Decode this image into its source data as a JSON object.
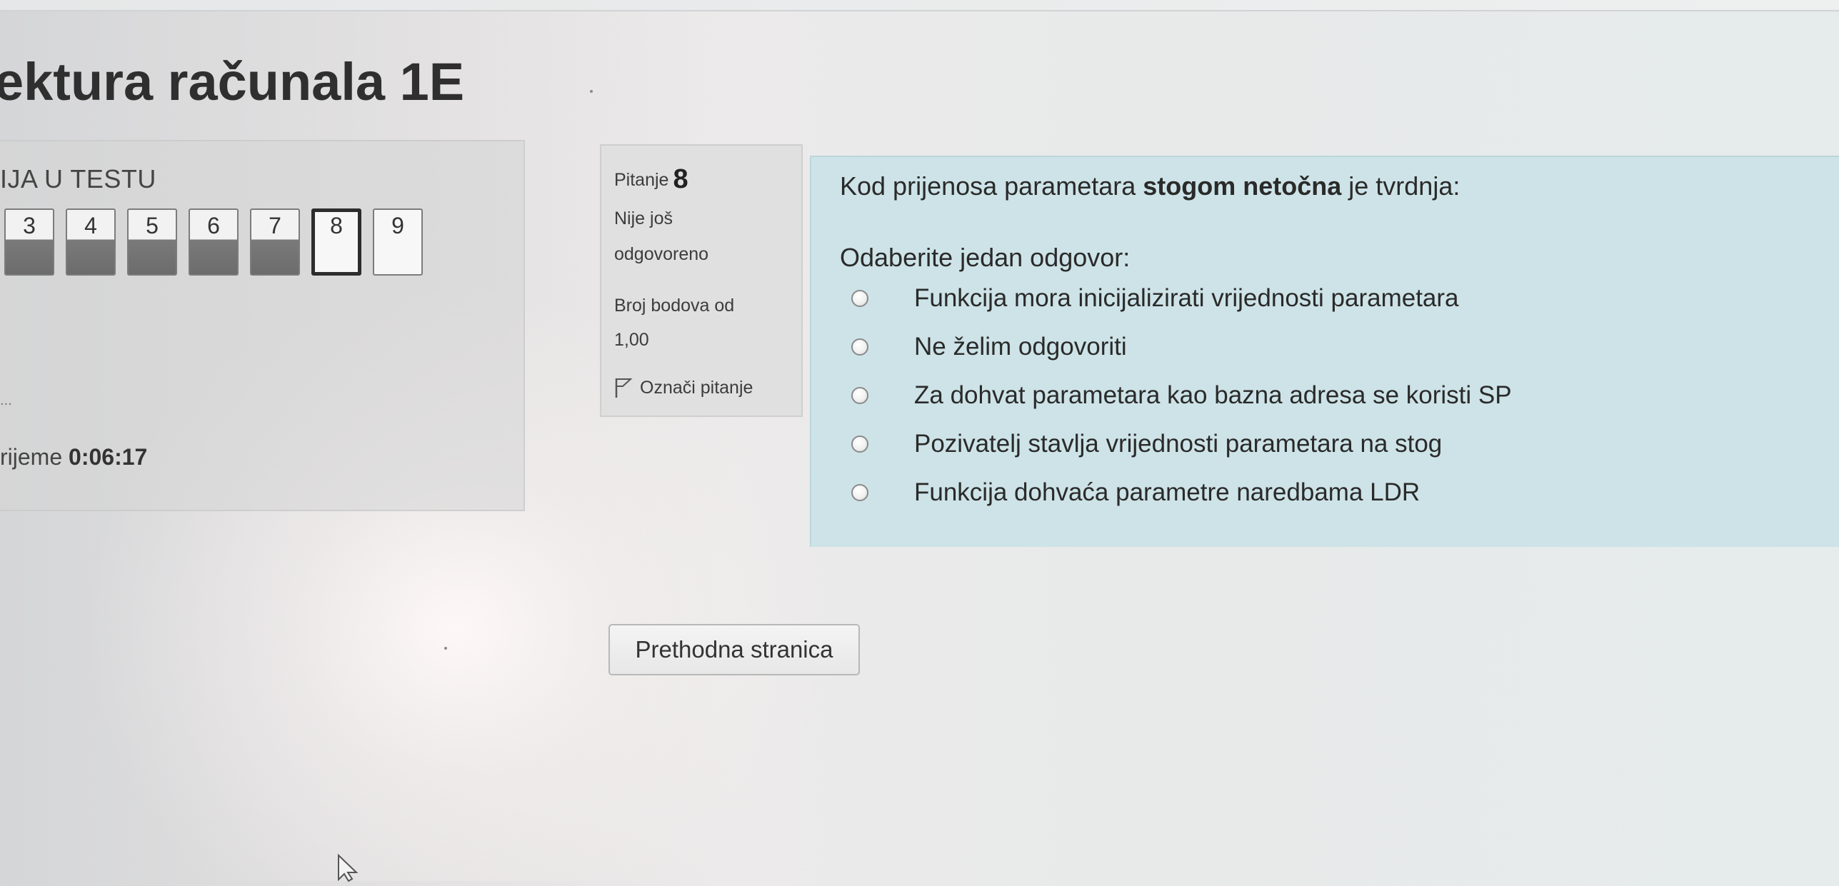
{
  "course": {
    "title": "ektura računala 1E"
  },
  "navigation": {
    "heading": "IJA U TESTU",
    "buttons": [
      {
        "label": "3",
        "state": "answered"
      },
      {
        "label": "4",
        "state": "answered"
      },
      {
        "label": "5",
        "state": "answered"
      },
      {
        "label": "6",
        "state": "answered"
      },
      {
        "label": "7",
        "state": "answered"
      },
      {
        "label": "8",
        "state": "current"
      },
      {
        "label": "9",
        "state": "unanswered"
      }
    ],
    "dots": "...",
    "timer_label": "rijeme",
    "timer_value": "0:06:17"
  },
  "question_info": {
    "label": "Pitanje",
    "number": "8",
    "state_line1": "Nije još",
    "state_line2": "odgovoreno",
    "mark_line1": "Broj bodova od",
    "mark_line2": "1,00",
    "flag_label": "Označi pitanje",
    "flag_icon": "flag-icon"
  },
  "question": {
    "text_before": "Kod prijenosa parametara ",
    "text_bold": "stogom netočna",
    "text_after": " je tvrdnja:",
    "prompt": "Odaberite jedan odgovor:",
    "answers": [
      "Funkcija mora inicijalizirati vrijednosti parametara",
      "Ne želim odgovoriti",
      "Za dohvat parametara kao bazna adresa se koristi SP",
      "Pozivatelj stavlja vrijednosti parametara na stog",
      "Funkcija dohvaća parametre naredbama LDR"
    ]
  },
  "footer": {
    "prev_button": "Prethodna stranica"
  },
  "colors": {
    "content_background": "#cde3e7",
    "answered_fill": "#6c6c6c",
    "current_border": "#2d2d2d"
  }
}
